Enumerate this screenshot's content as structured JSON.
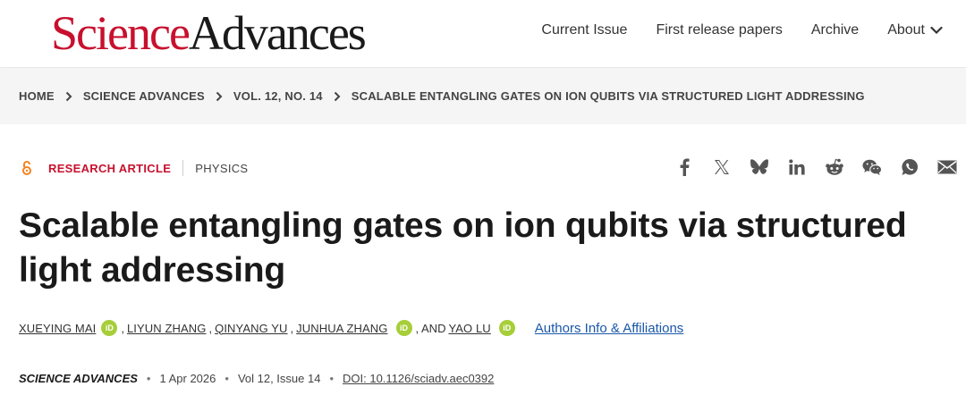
{
  "header": {
    "logo_science": "Science",
    "logo_advances": "Advances",
    "nav": [
      {
        "label": "Current Issue"
      },
      {
        "label": "First release papers"
      },
      {
        "label": "Archive"
      },
      {
        "label": "About"
      }
    ]
  },
  "breadcrumb": [
    "HOME",
    "SCIENCE ADVANCES",
    "VOL. 12, NO. 14",
    "SCALABLE ENTANGLING GATES ON ION QUBITS VIA STRUCTURED LIGHT ADDRESSING"
  ],
  "article": {
    "type": "RESEARCH ARTICLE",
    "subject": "PHYSICS",
    "title": "Scalable entangling gates on ion qubits via structured light addressing",
    "authors": {
      "a1": "XUEYING MAI",
      "sep1": ",",
      "a2": "LIYUN ZHANG",
      "sep2": ",",
      "a3": "QINYANG YU",
      "sep3": ",",
      "a4": "JUNHUA ZHANG",
      "sep4": ", AND",
      "a5": "YAO LU"
    },
    "orcid_label": "iD",
    "affiliations_link": "Authors Info & Affiliations",
    "citation": {
      "journal": "SCIENCE ADVANCES",
      "date": "1 Apr 2026",
      "volume_issue": "Vol 12, Issue 14",
      "doi": "DOI: 10.1126/sciadv.aec0392"
    }
  },
  "share_icons": [
    "facebook-icon",
    "x-icon",
    "bluesky-icon",
    "linkedin-icon",
    "reddit-icon",
    "wechat-icon",
    "whatsapp-icon",
    "email-icon"
  ],
  "colors": {
    "brand_red": "#c8102e",
    "link_blue": "#1a57a8",
    "orcid_green": "#a6ce39",
    "open_access_orange": "#f58220"
  }
}
